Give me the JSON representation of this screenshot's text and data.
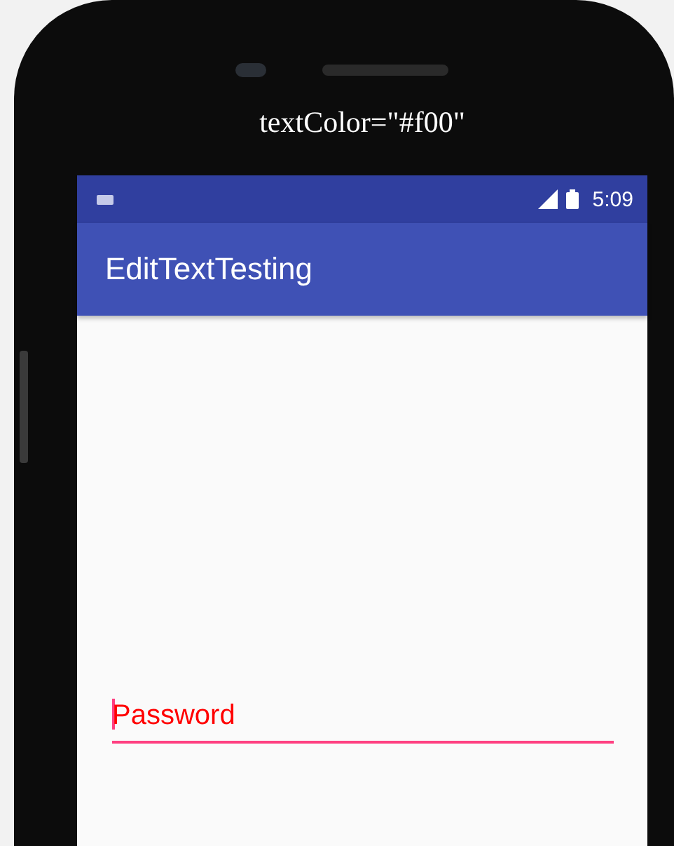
{
  "caption": "textColor=\"#f00\"",
  "status_bar": {
    "time": "5:09"
  },
  "app_bar": {
    "title": "EditTextTesting"
  },
  "password_field": {
    "value": "Password",
    "focused": true
  }
}
